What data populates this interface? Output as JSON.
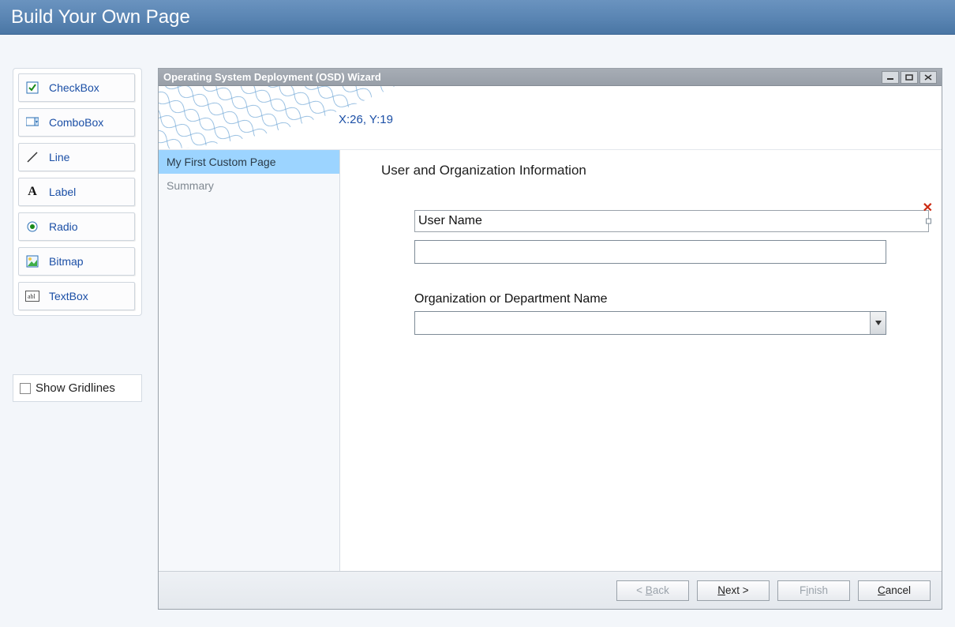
{
  "header": {
    "title": "Build Your Own Page"
  },
  "toolbox": {
    "items": [
      {
        "label": "CheckBox",
        "icon": "checkbox-icon"
      },
      {
        "label": "ComboBox",
        "icon": "combobox-icon"
      },
      {
        "label": "Line",
        "icon": "line-icon"
      },
      {
        "label": "Label",
        "icon": "label-icon"
      },
      {
        "label": "Radio",
        "icon": "radio-icon"
      },
      {
        "label": "Bitmap",
        "icon": "bitmap-icon"
      },
      {
        "label": "TextBox",
        "icon": "textbox-icon"
      }
    ]
  },
  "gridlines": {
    "label": "Show Gridlines",
    "checked": false
  },
  "wizard": {
    "title": "Operating System Deployment (OSD) Wizard",
    "coords": "X:26, Y:19",
    "nav": [
      {
        "label": "My First Custom Page",
        "active": true
      },
      {
        "label": "Summary",
        "active": false
      }
    ],
    "content": {
      "heading": "User and Organization Information",
      "user_name_label": "User Name",
      "user_name_value": "",
      "org_label": "Organization or Department Name",
      "org_value": ""
    },
    "footer": {
      "back": "< Back",
      "next": "Next >",
      "finish": "Finish",
      "cancel": "Cancel"
    }
  }
}
